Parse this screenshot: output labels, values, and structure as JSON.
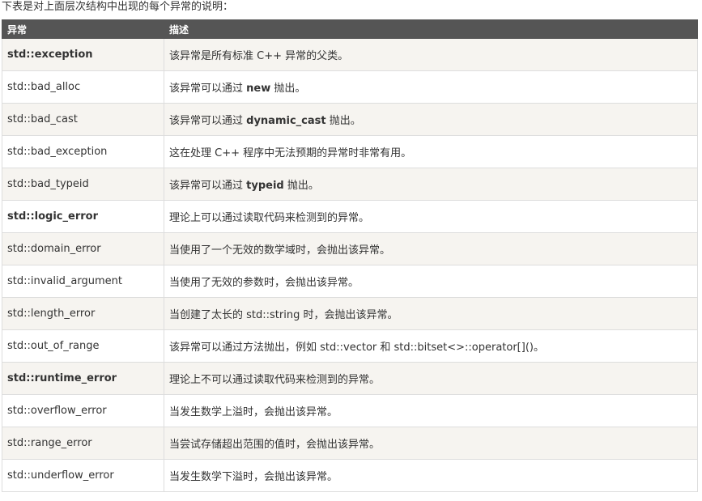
{
  "intro": "下表是对上面层次结构中出现的每个异常的说明：",
  "table": {
    "headers": [
      "异常",
      "描述"
    ],
    "rows": [
      {
        "name": "std::exception",
        "name_bold": true,
        "desc_pre": "该异常是所有标准 C++ 异常的父类。",
        "desc_kw": "",
        "desc_post": ""
      },
      {
        "name": "std::bad_alloc",
        "name_bold": false,
        "desc_pre": "该异常可以通过 ",
        "desc_kw": "new",
        "desc_post": " 抛出。"
      },
      {
        "name": "std::bad_cast",
        "name_bold": false,
        "desc_pre": "该异常可以通过 ",
        "desc_kw": "dynamic_cast",
        "desc_post": " 抛出。"
      },
      {
        "name": "std::bad_exception",
        "name_bold": false,
        "desc_pre": "这在处理 C++ 程序中无法预期的异常时非常有用。",
        "desc_kw": "",
        "desc_post": ""
      },
      {
        "name": "std::bad_typeid",
        "name_bold": false,
        "desc_pre": "该异常可以通过 ",
        "desc_kw": "typeid",
        "desc_post": " 抛出。"
      },
      {
        "name": "std::logic_error",
        "name_bold": true,
        "desc_pre": "理论上可以通过读取代码来检测到的异常。",
        "desc_kw": "",
        "desc_post": ""
      },
      {
        "name": "std::domain_error",
        "name_bold": false,
        "desc_pre": "当使用了一个无效的数学域时，会抛出该异常。",
        "desc_kw": "",
        "desc_post": ""
      },
      {
        "name": "std::invalid_argument",
        "name_bold": false,
        "desc_pre": "当使用了无效的参数时，会抛出该异常。",
        "desc_kw": "",
        "desc_post": ""
      },
      {
        "name": "std::length_error",
        "name_bold": false,
        "desc_pre": "当创建了太长的 std::string 时，会抛出该异常。",
        "desc_kw": "",
        "desc_post": ""
      },
      {
        "name": "std::out_of_range",
        "name_bold": false,
        "desc_pre": "该异常可以通过方法抛出，例如 std::vector 和 std::bitset<>::operator[]()。",
        "desc_kw": "",
        "desc_post": ""
      },
      {
        "name": "std::runtime_error",
        "name_bold": true,
        "desc_pre": "理论上不可以通过读取代码来检测到的异常。",
        "desc_kw": "",
        "desc_post": ""
      },
      {
        "name": "std::overflow_error",
        "name_bold": false,
        "desc_pre": "当发生数学上溢时，会抛出该异常。",
        "desc_kw": "",
        "desc_post": ""
      },
      {
        "name": "std::range_error",
        "name_bold": false,
        "desc_pre": "当尝试存储超出范围的值时，会抛出该异常。",
        "desc_kw": "",
        "desc_post": ""
      },
      {
        "name": "std::underflow_error",
        "name_bold": false,
        "desc_pre": "当发生数学下溢时，会抛出该异常。",
        "desc_kw": "",
        "desc_post": ""
      }
    ]
  }
}
